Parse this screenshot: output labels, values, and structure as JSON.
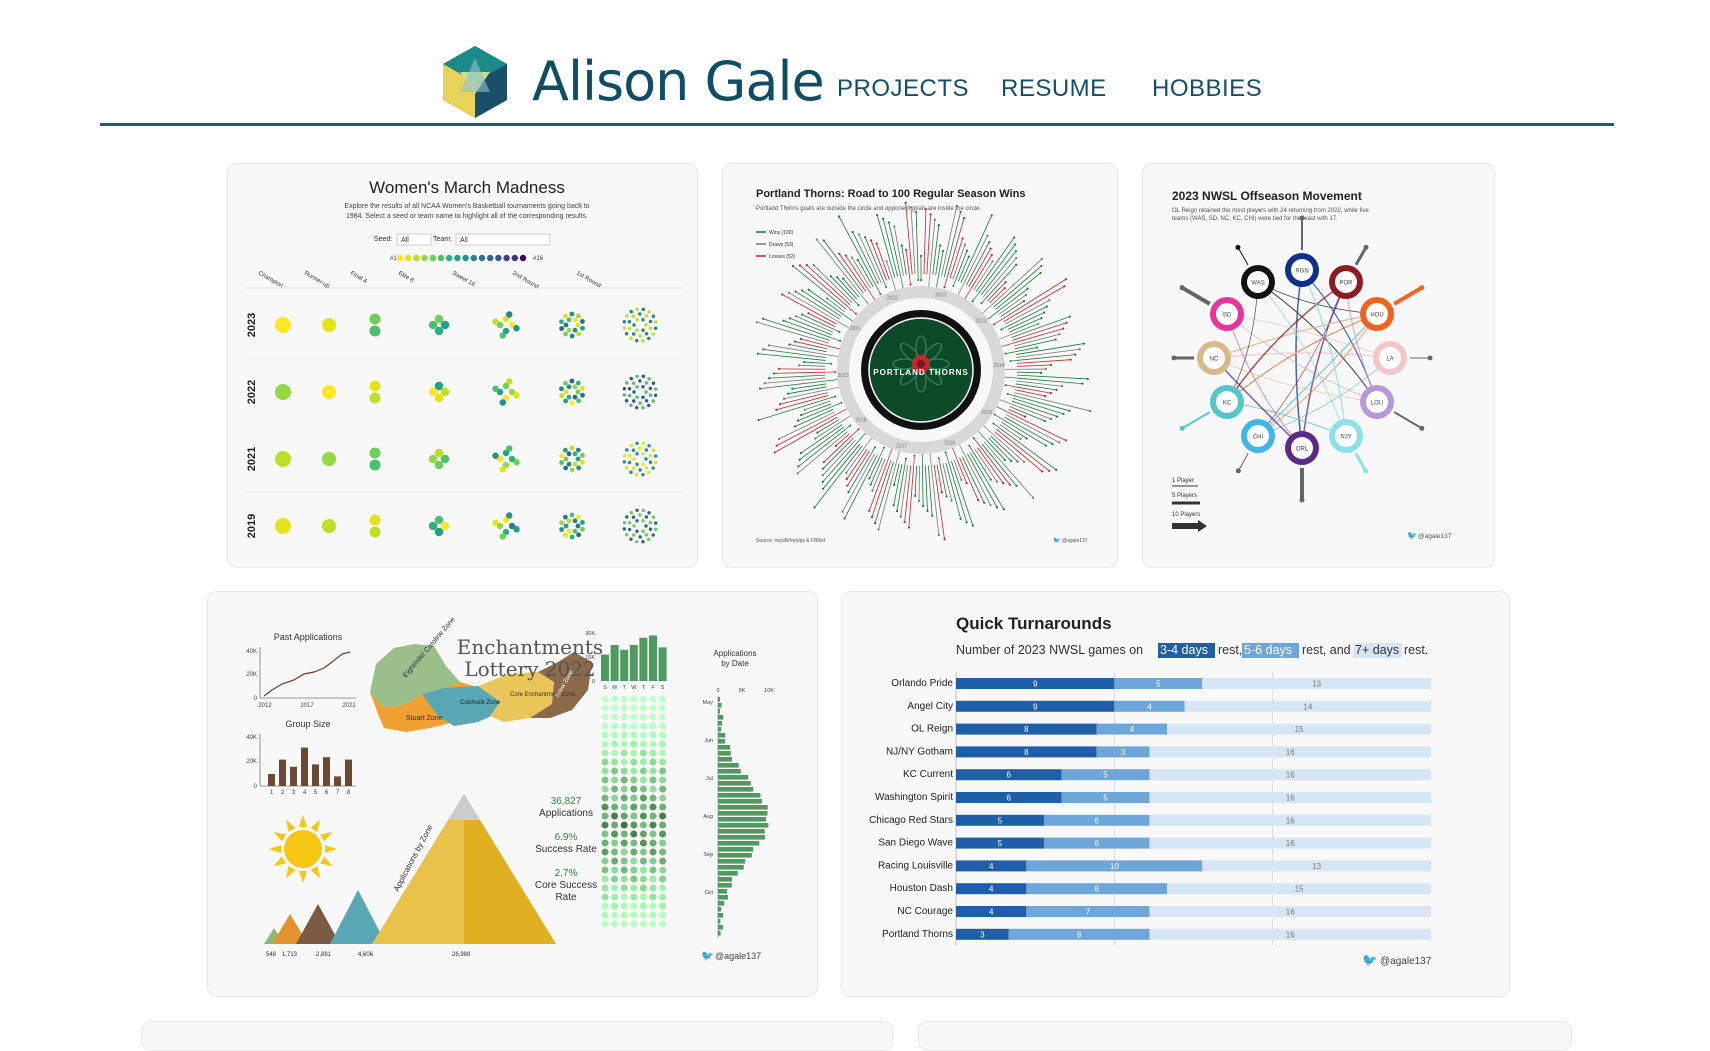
{
  "site": {
    "title": "Alison Gale",
    "colors": {
      "brand": "#0f4d63",
      "rule": "#1d5e6b"
    }
  },
  "nav": [
    {
      "label": "PROJECTS"
    },
    {
      "label": "RESUME"
    },
    {
      "label": "HOBBIES"
    }
  ],
  "cards": {
    "march": {
      "title": "Women's March Madness",
      "subtitle_1": "Explore the results of all NCAA Women's Basketball tournaments going back to",
      "subtitle_2": "1984. Select a seed or team name to highlight all of the corresponding results.",
      "seed_label": "Seed:",
      "seed_value": "All",
      "team_label": "Team:",
      "team_value": "All",
      "legend_start": "#1",
      "legend_end": "#16",
      "rounds": [
        "Champion",
        "Runner-up",
        "Final 4",
        "Elite 8",
        "Sweet 16",
        "2nd Round",
        "1st Round"
      ],
      "years": [
        "2023",
        "2022",
        "2021",
        "2019"
      ]
    },
    "thorns": {
      "title": "Portland Thorns: Road to 100 Regular Season Wins",
      "subtitle": "Portland Thorns goals are outside the circle and opponent goals are inside the circle.",
      "legend": [
        "Wins (100)",
        "Draws (53)",
        "Losses (52)"
      ],
      "ring_years": [
        "2022",
        "2023",
        "2013",
        "2014",
        "2015",
        "2016",
        "2017",
        "2018",
        "2019",
        "2021"
      ],
      "logo_text": "PORTLAND THORNS",
      "source": "Source: nwslR/nwslpy & FBRef",
      "handle": "@agale137"
    },
    "offseason": {
      "title": "2023 NWSL Offseason Movement",
      "subtitle_1": "OL Reign retained the most players with 24 returning from 2022, while five",
      "subtitle_2": "teams (WAS, SD, NC, KC, CHI) were tied for the least with 17.",
      "teams": [
        "WAS",
        "RGN",
        "POR",
        "HOU",
        "LA",
        "LOU",
        "NJY",
        "ORL",
        "CHI",
        "KC",
        "NC",
        "SD"
      ],
      "legend": [
        "1 Player",
        "5 Players",
        "10 Players"
      ],
      "handle": "@agale137"
    },
    "enchantments": {
      "title_1": "Enchantments",
      "title_2": "Lottery 2022",
      "past_title": "Past Applications",
      "past_y": [
        "40K",
        "20K",
        "0"
      ],
      "past_x": [
        "2012",
        "2017",
        "2022"
      ],
      "group_title": "Group Size",
      "group_y": [
        "40K",
        "20K",
        "0"
      ],
      "group_x": [
        "1",
        "2",
        "3",
        "4",
        "5",
        "6",
        "7",
        "8"
      ],
      "zones": [
        "Eightmile/ Caroline Zone",
        "Stuart Zone",
        "Colchuck Zone",
        "Core Enchantment Zone",
        "Snow Zone"
      ],
      "stats": [
        {
          "value": "36,827",
          "label": "Applications"
        },
        {
          "value": "6.9%",
          "label": "Success Rate"
        },
        {
          "value": "2.7%",
          "label": "Core Success",
          "label2": "Rate"
        }
      ],
      "mountain_axis": "Applications by Zone",
      "mountain_values": [
        "548",
        "1,713",
        "2,881",
        "4,606",
        "26,988"
      ],
      "date_title_1": "Applications",
      "date_title_2": "by Date",
      "bar_axis": [
        "30K",
        "15K",
        "0"
      ],
      "weekdays": [
        "S",
        "M",
        "T",
        "W",
        "T",
        "F",
        "S"
      ],
      "hist_axis": [
        "0",
        "5K",
        "10K"
      ],
      "months": [
        "May",
        "Jun",
        "Jul",
        "Aug",
        "Sep",
        "Oct"
      ],
      "handle": "@agale137"
    },
    "turnarounds": {
      "title": "Quick Turnarounds",
      "subtitle_pre": "Number of 2023 NWSL games on",
      "hl1": "3-4 days",
      "mid1": "rest,",
      "hl2": "5-6 days",
      "mid2": "rest, and",
      "hl3": "7+ days",
      "end": "rest.",
      "handle": "@agale137",
      "colors": {
        "short": "#1f5fa8",
        "mid": "#6fa6da",
        "long": "#d6e6f5"
      }
    }
  },
  "chart_data": {
    "type": "bar",
    "title": "Quick Turnarounds",
    "categories": [
      "Orlando Pride",
      "Angel City",
      "OL Reign",
      "NJ/NY Gotham",
      "KC Current",
      "Washington Spirit",
      "Chicago Red Stars",
      "San Diego Wave",
      "Racing Louisville",
      "Houston Dash",
      "NC Courage",
      "Portland Thorns"
    ],
    "series": [
      {
        "name": "3-4 days",
        "values": [
          9,
          9,
          8,
          8,
          6,
          6,
          5,
          5,
          4,
          4,
          4,
          3
        ]
      },
      {
        "name": "5-6 days",
        "values": [
          5,
          4,
          4,
          3,
          5,
          5,
          6,
          6,
          10,
          8,
          7,
          8
        ]
      },
      {
        "name": "7+ days",
        "values": [
          13,
          14,
          15,
          16,
          16,
          16,
          16,
          16,
          13,
          15,
          16,
          16
        ]
      }
    ],
    "stacked": true,
    "orientation": "horizontal",
    "xlim": [
      0,
      27
    ]
  }
}
